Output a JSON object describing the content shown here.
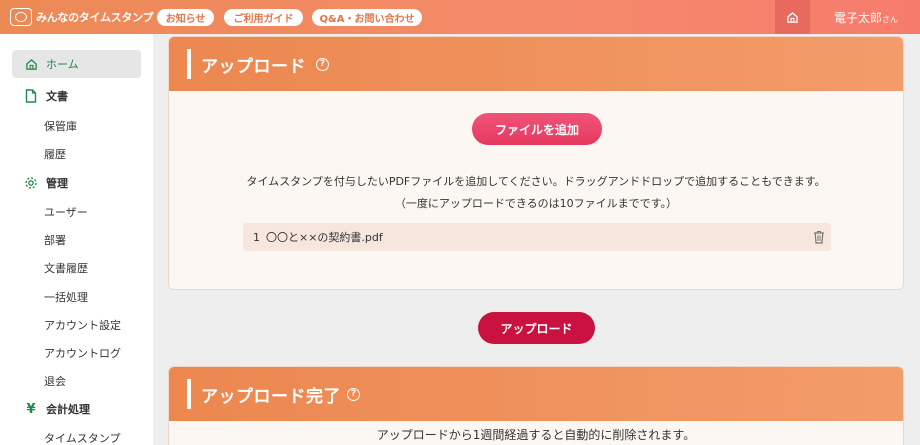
{
  "header": {
    "logo_text": "みんなのタイムスタンプ",
    "nav": [
      "お知らせ",
      "ご利用ガイド",
      "Q&A・お問い合わせ"
    ],
    "user_name": "電子太郎",
    "user_suffix": "さん"
  },
  "sidebar": {
    "items": [
      {
        "label": "ホーム",
        "icon": "home-icon",
        "active": true
      },
      {
        "label": "文書",
        "icon": "document-icon"
      },
      {
        "label": "保管庫"
      },
      {
        "label": "履歴"
      },
      {
        "label": "管理",
        "icon": "gear-icon"
      },
      {
        "label": "ユーザー"
      },
      {
        "label": "部署"
      },
      {
        "label": "文書履歴"
      },
      {
        "label": "一括処理"
      },
      {
        "label": "アカウント設定"
      },
      {
        "label": "アカウントログ"
      },
      {
        "label": "退会"
      },
      {
        "label": "会計処理",
        "icon": "yen-icon"
      },
      {
        "label": "タイムスタンプ"
      }
    ]
  },
  "upload_card": {
    "title": "アップロード",
    "add_file_button": "ファイルを追加",
    "description": "タイムスタンプを付与したいPDFファイルを追加してください。ドラッグアンドドロップで追加することもできます。",
    "note": "（一度にアップロードできるのは10ファイルまでです。）",
    "files": [
      {
        "number": "1",
        "name": "〇〇と××の契約書.pdf"
      }
    ]
  },
  "upload_button": "アップロード",
  "complete_card": {
    "title": "アップロード完了",
    "message": "アップロードから1週間経過すると自動的に削除されます。"
  },
  "colors": {
    "accent": "#ec874f",
    "primary_button": "#c9123f",
    "add_button": "#e6385f",
    "active_text": "#1e8a4f"
  }
}
